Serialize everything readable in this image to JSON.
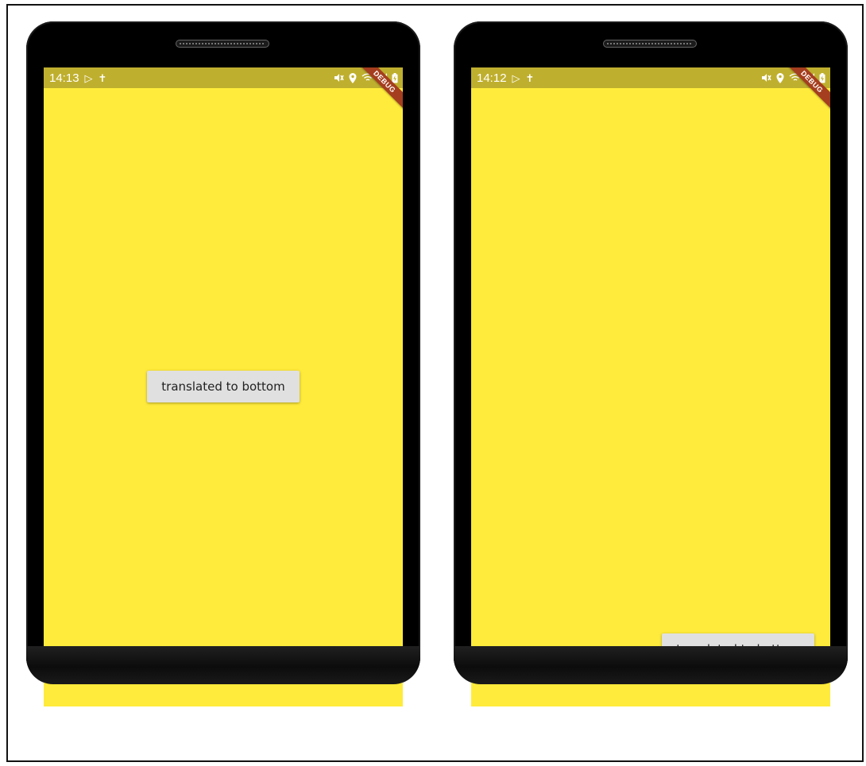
{
  "phones": [
    {
      "status_time": "14:13",
      "debug_label": "DEBUG",
      "button_label": "translated to bottom"
    },
    {
      "status_time": "14:12",
      "debug_label": "DEBUG",
      "button_label": "translated to bottom"
    }
  ],
  "colors": {
    "screen_background": "#FFEB3B",
    "status_bar": "#BFAF2E",
    "button": "#E0E0E0",
    "debug_banner": "#A53E1E"
  },
  "icons": [
    "play-store-icon",
    "notification-icon",
    "mute-icon",
    "location-icon",
    "wifi-icon",
    "signal-icon",
    "battery-charging-icon"
  ]
}
